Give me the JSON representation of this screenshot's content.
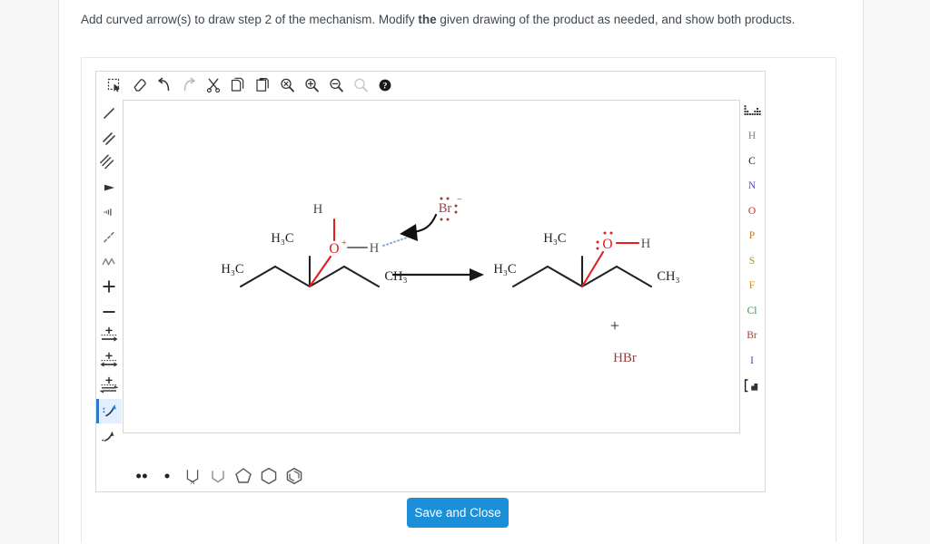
{
  "prompt": {
    "line1_a": "Add curved arrow(s) to draw step 2 of the mechanism. Modify ",
    "line1_b": "the",
    "line1_c": " given drawing of the product as needed, and show both",
    "line2": "products."
  },
  "toolbar_top": [
    {
      "name": "select-lasso-icon",
      "label": "Select"
    },
    {
      "name": "eraser-icon",
      "label": "Erase"
    },
    {
      "name": "undo-icon",
      "label": "Undo"
    },
    {
      "name": "redo-icon",
      "label": "Redo"
    },
    {
      "name": "cut-scissors-icon",
      "label": "Cut"
    },
    {
      "name": "copy-icon",
      "label": "Copy"
    },
    {
      "name": "paste-icon",
      "label": "Paste"
    },
    {
      "name": "zoom-reset-icon",
      "label": "Reset zoom"
    },
    {
      "name": "zoom-in-icon",
      "label": "Zoom in"
    },
    {
      "name": "zoom-out-icon",
      "label": "Zoom out"
    },
    {
      "name": "zoom-fit-icon",
      "label": "Zoom to fit"
    },
    {
      "name": "help-icon",
      "label": "Help"
    }
  ],
  "toolbar_left": [
    {
      "name": "single-bond-tool",
      "label": "Single bond",
      "selected": false
    },
    {
      "name": "double-bond-tool",
      "label": "Double bond",
      "selected": false
    },
    {
      "name": "triple-bond-tool",
      "label": "Triple bond",
      "selected": false
    },
    {
      "name": "wedge-bond-tool",
      "label": "Wedge bond",
      "selected": false
    },
    {
      "name": "hashed-wedge-bond-tool",
      "label": "Hashed wedge bond",
      "selected": false
    },
    {
      "name": "dashed-bond-tool",
      "label": "Dashed bond",
      "selected": false
    },
    {
      "name": "chain-tool",
      "label": "Chain",
      "selected": false
    },
    {
      "name": "plus-charge-tool",
      "label": "Add positive charge",
      "selected": false
    },
    {
      "name": "minus-charge-tool",
      "label": "Add negative charge",
      "selected": false
    },
    {
      "name": "reaction-arrow-tool",
      "label": "Reaction arrow",
      "selected": false
    },
    {
      "name": "resonance-arrow-tool",
      "label": "Resonance arrow",
      "selected": false
    },
    {
      "name": "equilibrium-arrow-tool",
      "label": "Equilibrium arrow",
      "selected": false
    },
    {
      "name": "curved-arrow-double-barb-tool",
      "label": "Curved arrow (two electrons)",
      "selected": true
    },
    {
      "name": "curved-arrow-single-barb-tool",
      "label": "Curved arrow (one electron)",
      "selected": false
    }
  ],
  "toolbar_bottom": [
    {
      "name": "lone-pair-tool",
      "label": "Lone pair"
    },
    {
      "name": "radical-tool",
      "label": "Radical electron"
    },
    {
      "name": "pyrrole-ring-tool",
      "label": "Pyrrole"
    },
    {
      "name": "cyclobutane-ring-tool",
      "label": "Cyclobutane"
    },
    {
      "name": "cyclopentane-ring-tool",
      "label": "Cyclopentane"
    },
    {
      "name": "cyclohexane-ring-tool",
      "label": "Cyclohexane"
    },
    {
      "name": "benzene-ring-tool",
      "label": "Benzene"
    }
  ],
  "palette_right": {
    "periodic_table_label": "Periodic table",
    "bracket_label": "Brackets",
    "elements": [
      {
        "symbol": "H",
        "color": "#808080"
      },
      {
        "symbol": "C",
        "color": "#1a1a1a"
      },
      {
        "symbol": "N",
        "color": "#4a4ad0"
      },
      {
        "symbol": "O",
        "color": "#e02020"
      },
      {
        "symbol": "P",
        "color": "#c07818"
      },
      {
        "symbol": "S",
        "color": "#a89018"
      },
      {
        "symbol": "F",
        "color": "#c89018"
      },
      {
        "symbol": "Cl",
        "color": "#1f9f3f"
      },
      {
        "symbol": "Br",
        "color": "#9b4040"
      },
      {
        "symbol": "I",
        "color": "#7038a8"
      }
    ]
  },
  "canvas": {
    "reactant": {
      "labels": {
        "h_top": "H",
        "methyl_upper": "H₃C",
        "methyl_left": "H₃C",
        "methyl_right": "CH₃",
        "oxygen": "O",
        "oxygen_charge": "+",
        "h_right": "H",
        "bromide": "Br",
        "bromide_charge": "−"
      },
      "colors": {
        "oxygen": "#e02020",
        "bromide": "#9b4040",
        "bond": "#222222"
      }
    },
    "reaction_arrow": {
      "name": "reaction-arrow",
      "color": "#1a1a1a"
    },
    "product": {
      "labels": {
        "methyl_upper": "H₃C",
        "methyl_left": "H₃C",
        "methyl_right": "CH₃",
        "oxygen": "O",
        "h_right": "H"
      },
      "colors": {
        "oxygen": "#e02020",
        "bond": "#222222"
      }
    },
    "plus_sign": "+",
    "byproduct": {
      "formula": "HBr",
      "color": "#9b4040"
    }
  },
  "save_button": {
    "label": "Save and Close",
    "color": "#1b8fd7"
  }
}
